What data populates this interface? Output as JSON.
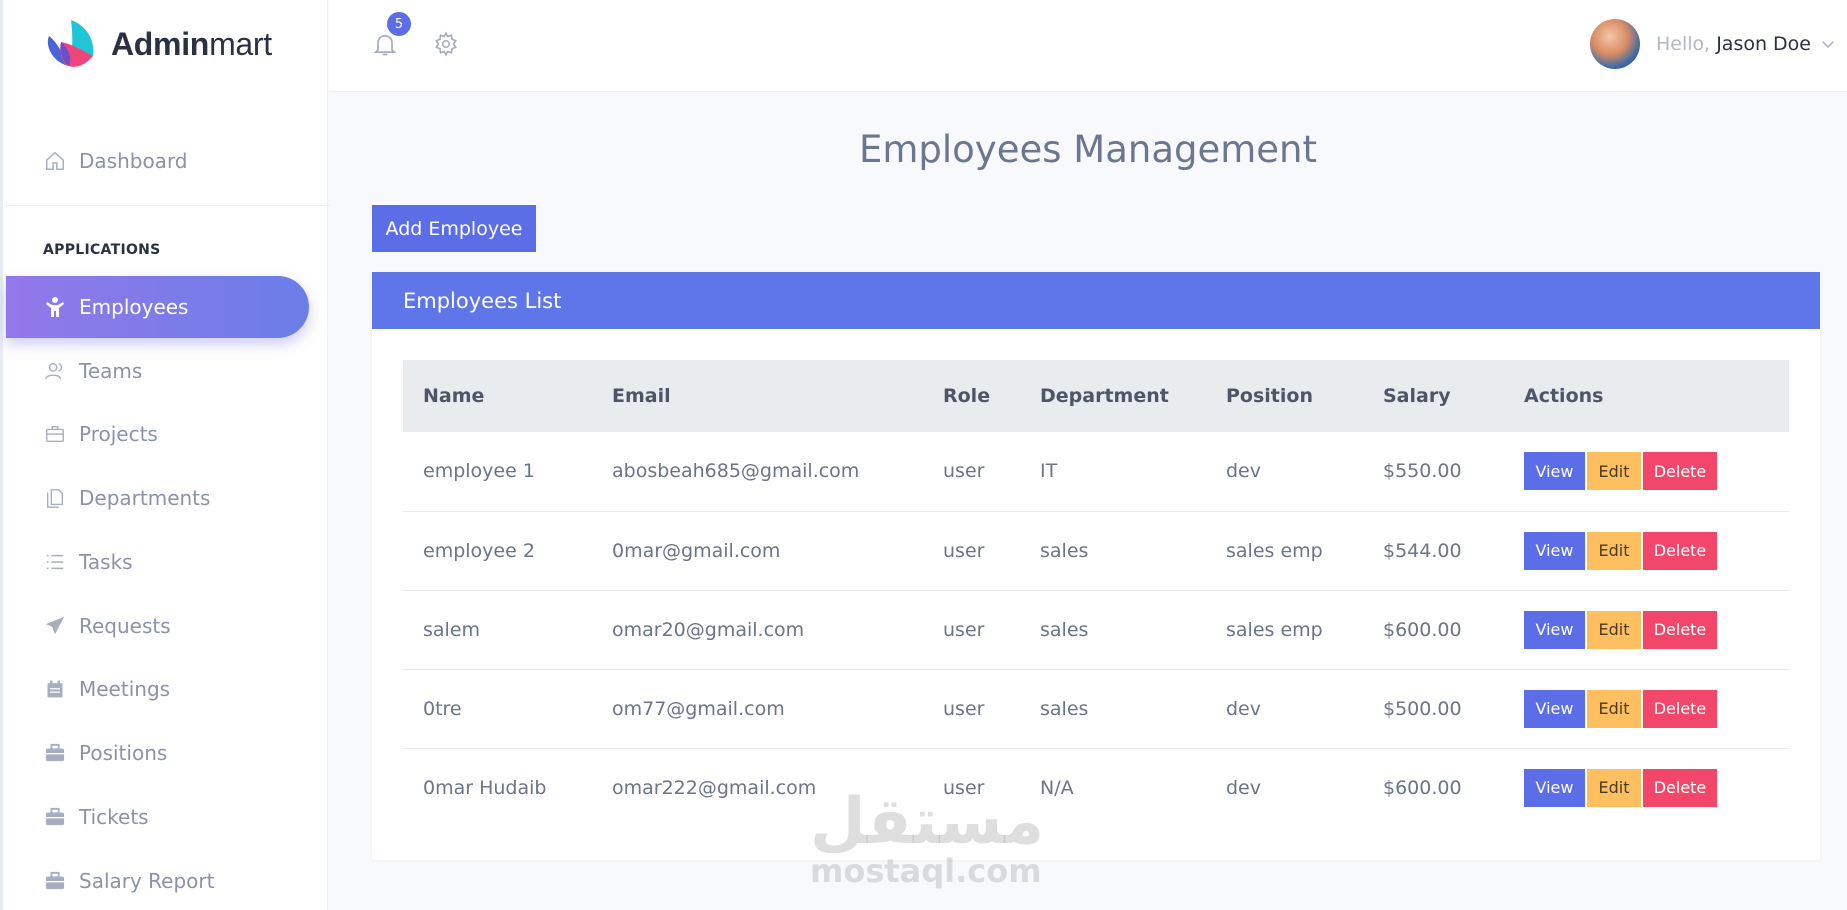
{
  "app": {
    "logo_bold": "Admin",
    "logo_rest": "mart"
  },
  "sidebar": {
    "dashboard": "Dashboard",
    "section_title": "APPLICATIONS",
    "items": [
      {
        "label": "Employees",
        "icon": "employee-icon",
        "active": true
      },
      {
        "label": "Teams",
        "icon": "teams-icon"
      },
      {
        "label": "Projects",
        "icon": "briefcase-icon"
      },
      {
        "label": "Departments",
        "icon": "documents-icon"
      },
      {
        "label": "Tasks",
        "icon": "list-icon"
      },
      {
        "label": "Requests",
        "icon": "paper-plane-icon"
      },
      {
        "label": "Meetings",
        "icon": "calendar-icon"
      },
      {
        "label": "Positions",
        "icon": "toolbox-icon"
      },
      {
        "label": "Tickets",
        "icon": "toolbox-icon"
      },
      {
        "label": "Salary Report",
        "icon": "toolbox-icon"
      }
    ]
  },
  "topbar": {
    "notifications_count": "5",
    "greeting": "Hello,",
    "user_name": "Jason Doe"
  },
  "main": {
    "title": "Employees Management",
    "add_button": "Add Employee",
    "card_title": "Employees List",
    "columns": [
      "Name",
      "Email",
      "Role",
      "Department",
      "Position",
      "Salary",
      "Actions"
    ],
    "rows": [
      {
        "name": "employee 1",
        "email": "abosbeah685@gmail.com",
        "role": "user",
        "department": "IT",
        "position": "dev",
        "salary": "$550.00"
      },
      {
        "name": "employee 2",
        "email": "0mar@gmail.com",
        "role": "user",
        "department": "sales",
        "position": "sales emp",
        "salary": "$544.00"
      },
      {
        "name": "salem",
        "email": "omar20@gmail.com",
        "role": "user",
        "department": "sales",
        "position": "sales emp",
        "salary": "$600.00"
      },
      {
        "name": "0tre",
        "email": "om77@gmail.com",
        "role": "user",
        "department": "sales",
        "position": "dev",
        "salary": "$500.00"
      },
      {
        "name": "0mar Hudaib",
        "email": "omar222@gmail.com",
        "role": "user",
        "department": "N/A",
        "position": "dev",
        "salary": "$600.00"
      }
    ],
    "actions": {
      "view": "View",
      "edit": "Edit",
      "delete": "Delete"
    }
  },
  "watermark": {
    "arabic": "مستقل",
    "latin": "mostaql.com"
  },
  "colors": {
    "accent": "#5b6ee8",
    "edit": "#fdbf60",
    "delete": "#f2476b",
    "header": "#5f76e8"
  }
}
